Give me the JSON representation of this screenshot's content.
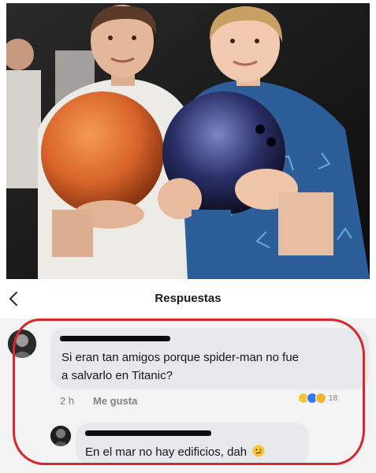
{
  "header": {
    "title": "Respuestas"
  },
  "comment": {
    "text_line1": "Si eran tan amigos porque spider-man no fue",
    "text_line2": "a salvarlo en Titanic?",
    "time": "2 h",
    "like_label": "Me gusta",
    "reaction_count": "18"
  },
  "reply": {
    "text": "En el mar no hay edificios, dah"
  },
  "colors": {
    "red_outline": "#d8262a",
    "bubble": "#e6e8ec",
    "like_blue": "#2d7cf6",
    "haha_yellow": "#f7c637"
  },
  "icons": {
    "back": "chevron-left-icon",
    "reactions": [
      "haha-icon",
      "like-icon",
      "wow-icon"
    ],
    "emoji": "smirk-emoji-icon"
  }
}
